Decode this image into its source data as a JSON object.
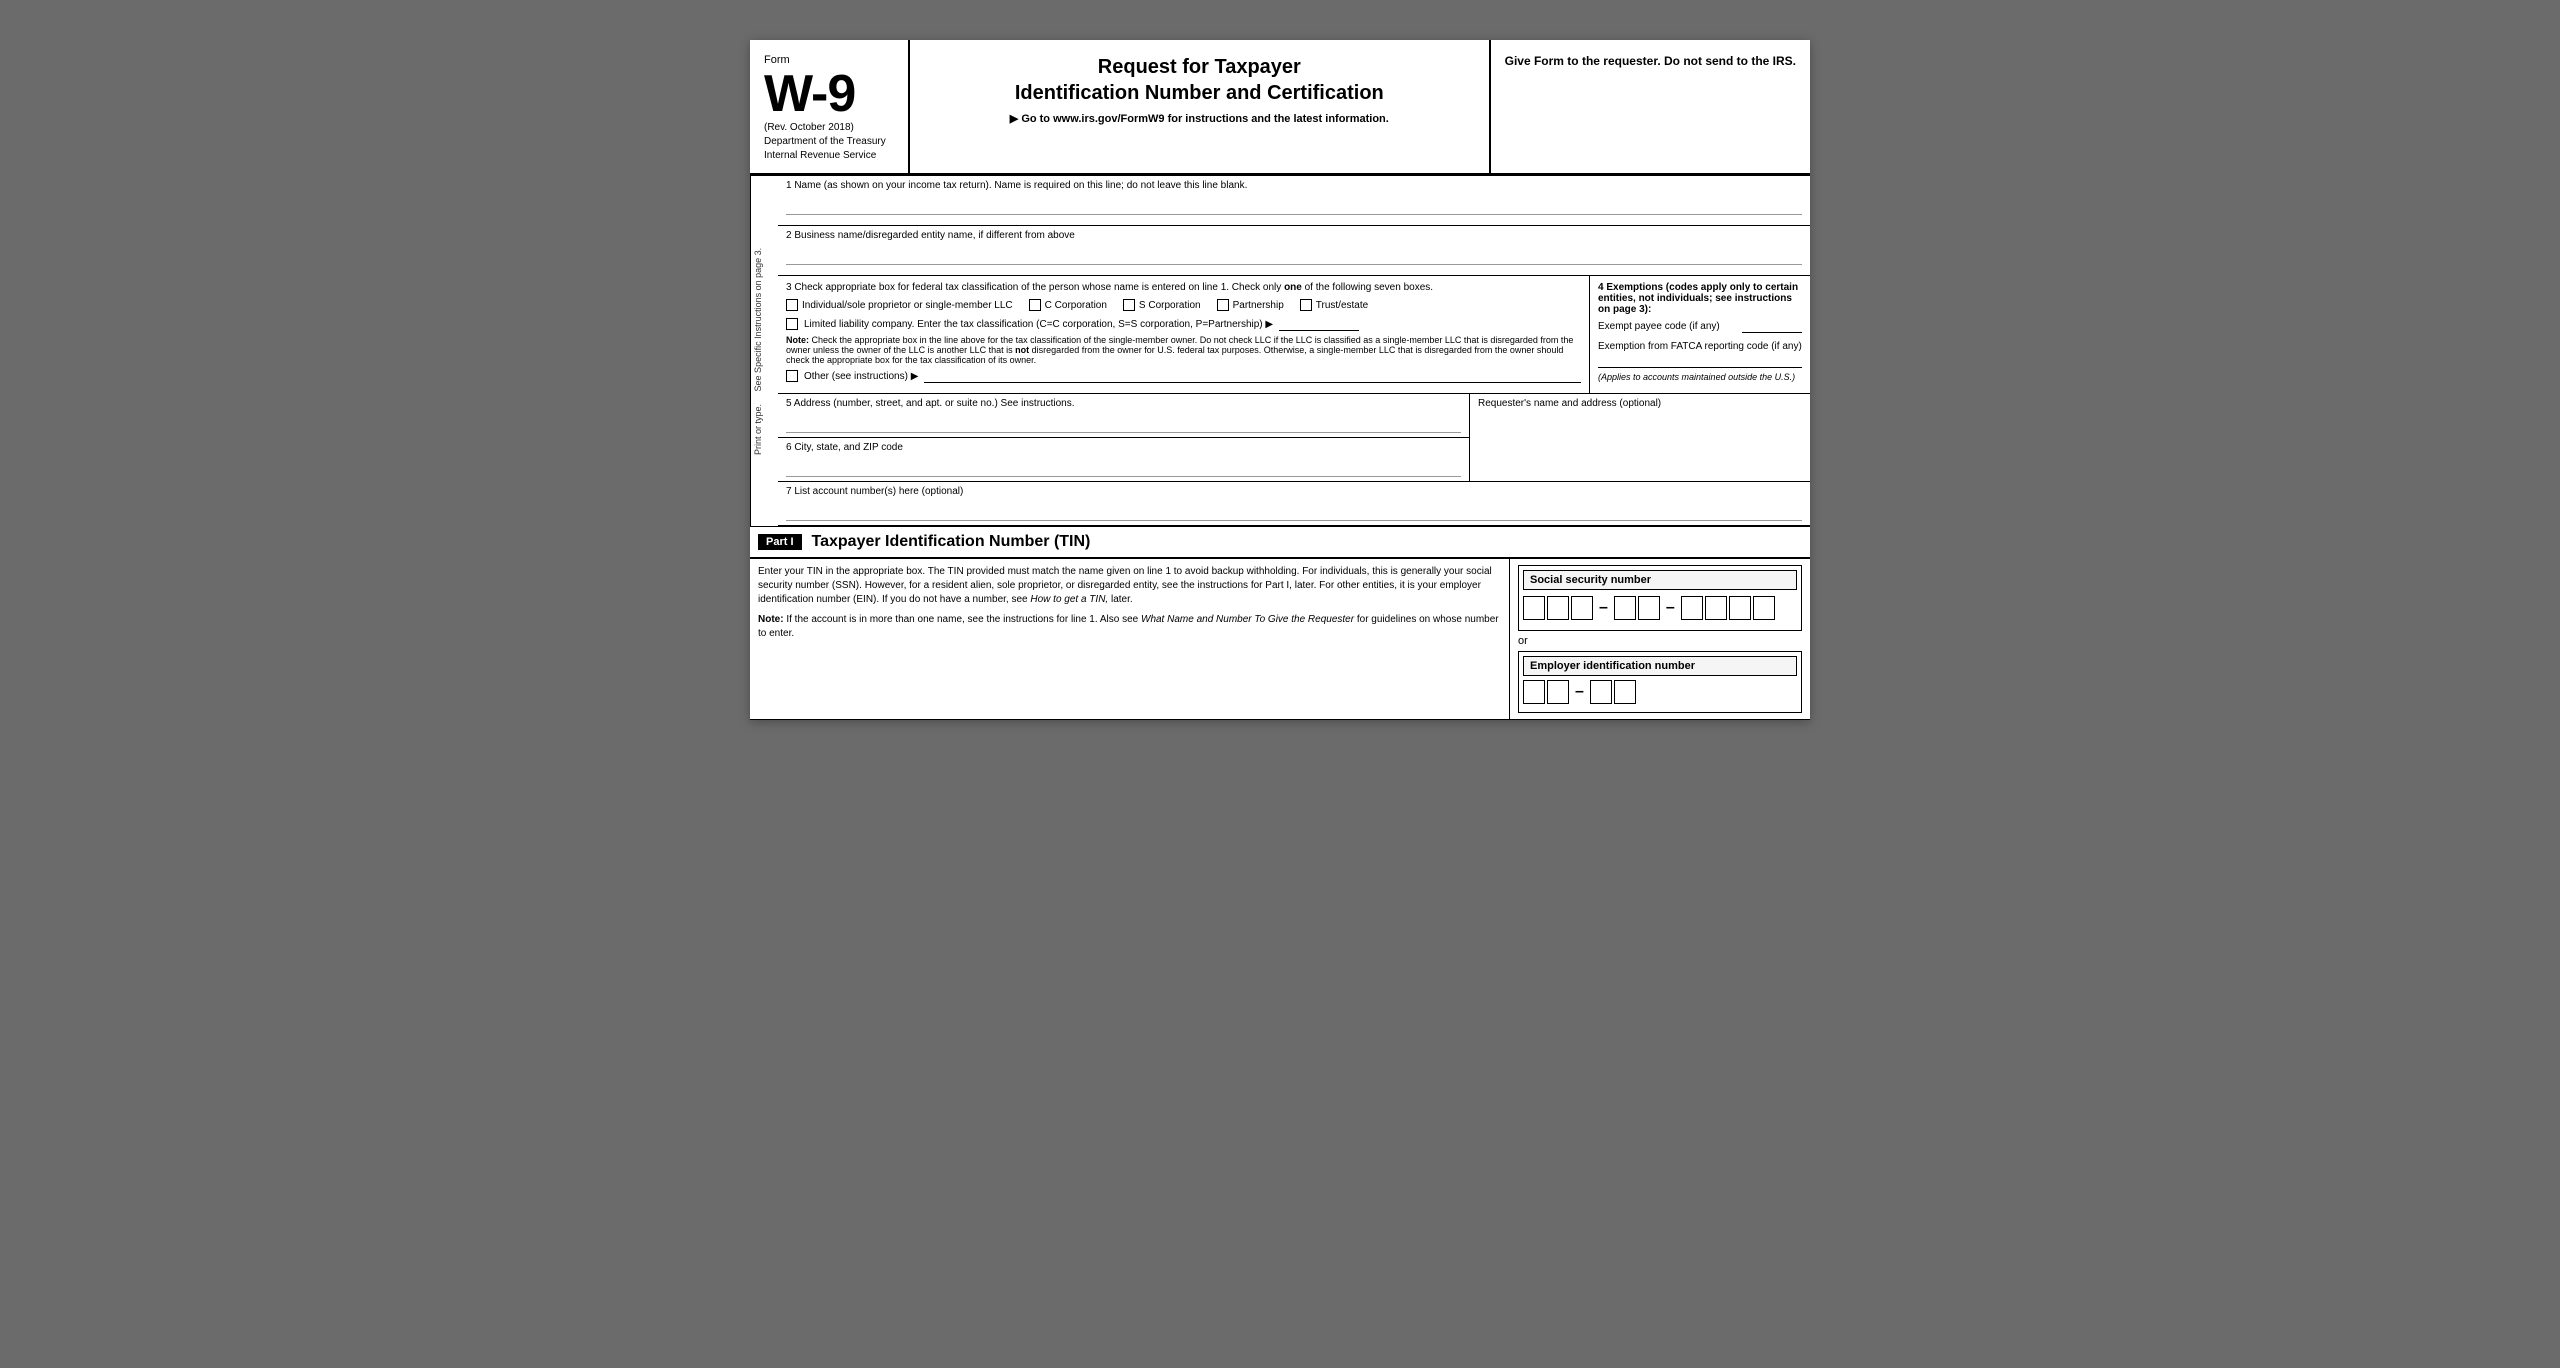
{
  "header": {
    "form_label": "Form",
    "form_number": "W-9",
    "rev": "(Rev. October 2018)",
    "dept": "Department of the Treasury",
    "irs": "Internal Revenue Service",
    "title_line1": "Request for Taxpayer",
    "title_line2": "Identification Number and Certification",
    "goto": "▶ Go to www.irs.gov/FormW9 for instructions and the latest information.",
    "right_text": "Give Form to the requester. Do not send to the IRS."
  },
  "fields": {
    "field1_label": "1  Name (as shown on your income tax return). Name is required on this line; do not leave this line blank.",
    "field2_label": "2  Business name/disregarded entity name, if different from above",
    "field3_label": "3  Check appropriate box for federal tax classification of the person whose name is entered on line 1. Check only",
    "field3_bold": "one",
    "field3_label2": "of the following seven boxes.",
    "field4_label": "4  Exemptions (codes apply only to certain entities, not individuals; see instructions on page 3):",
    "exempt_payee_label": "Exempt payee code (if any)",
    "fatca_label": "Exemption from FATCA reporting code (if any)",
    "applies_text": "(Applies to accounts maintained outside the U.S.)",
    "checkboxes": [
      {
        "label": "Individual/sole proprietor or single-member LLC"
      },
      {
        "label": "C Corporation"
      },
      {
        "label": "S Corporation"
      },
      {
        "label": "Partnership"
      },
      {
        "label": "Trust/estate"
      }
    ],
    "llc_label": "Limited liability company. Enter the tax classification (C=C corporation, S=S corporation, P=Partnership) ▶",
    "note_label": "Note:",
    "note_text": "Check the appropriate box in the line above for the tax classification of the single-member owner.  Do not check LLC if the LLC is classified as a single-member LLC that is disregarded from the owner unless the owner of the LLC is another LLC that is",
    "note_not": "not",
    "note_text2": "disregarded from the owner for U.S. federal tax purposes. Otherwise, a single-member LLC that is disregarded from the owner should check the appropriate box for the tax classification of its owner.",
    "other_label": "Other (see instructions) ▶",
    "field5_label": "5  Address (number, street, and apt. or suite no.) See instructions.",
    "requester_label": "Requester's name and address (optional)",
    "field6_label": "6  City, state, and ZIP code",
    "field7_label": "7  List account number(s) here (optional)",
    "side_label1": "Print or type.",
    "side_label2": "See Specific Instructions on page 3."
  },
  "part_i": {
    "part_label": "Part I",
    "part_title": "Taxpayer Identification Number (TIN)",
    "text1": "Enter your TIN in the appropriate box. The TIN provided must match the name given on line 1 to avoid backup withholding. For individuals, this is generally your social security number (SSN). However, for a resident alien, sole proprietor, or disregarded entity, see the instructions for Part I, later. For other entities, it is your employer identification number (EIN). If you do not have a number, see",
    "text1_italic": "How to get a TIN,",
    "text1_end": "later.",
    "note_label": "Note:",
    "note_text": "If the account is in more than one name, see the instructions for line 1. Also see",
    "note_italic": "What Name and Number To Give the Requester",
    "note_end": "for guidelines on whose number to enter.",
    "ssn_label": "Social security number",
    "or_text": "or",
    "ein_label": "Employer identification number"
  }
}
